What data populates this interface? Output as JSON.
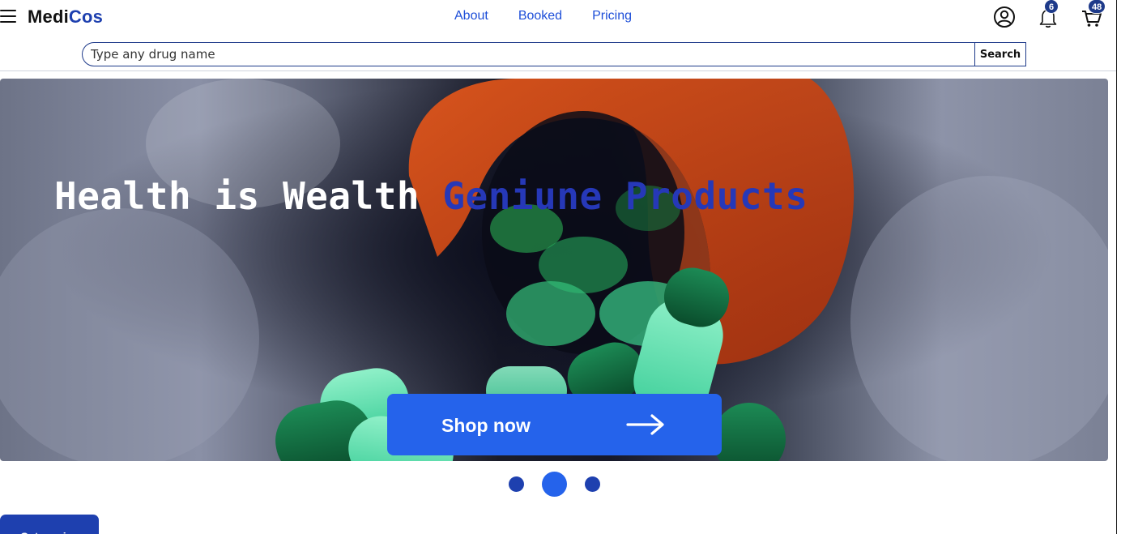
{
  "brand": {
    "part1": "Medi",
    "part2": "Cos"
  },
  "nav": {
    "links": [
      "About",
      "Booked",
      "Pricing"
    ]
  },
  "header_icons": {
    "account": {
      "icon": "user-circle-icon"
    },
    "notifications": {
      "icon": "bell-icon",
      "count": "6"
    },
    "cart": {
      "icon": "cart-icon",
      "count": "48"
    }
  },
  "search": {
    "placeholder": "Type any drug name",
    "button_label": "Search"
  },
  "hero": {
    "title_white": "Health is Wealth ",
    "title_blue": "Geniune Products",
    "cta_label": "Shop now",
    "cta_icon": "arrow-right-icon"
  },
  "carousel": {
    "slides": 3,
    "active_index": 1
  },
  "categories": {
    "button_label": "Categories"
  },
  "colors": {
    "accent": "#2563eb",
    "brand_blue": "#1e40af",
    "dark_blue": "#1e3a8a"
  }
}
